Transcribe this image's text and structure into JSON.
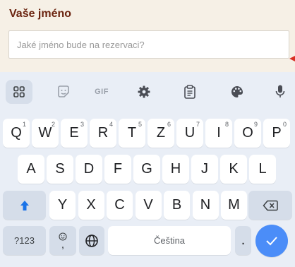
{
  "form": {
    "label": "Vaše jméno",
    "placeholder": "Jaké jméno bude na rezervaci?",
    "value": ""
  },
  "keyboard": {
    "toolbar": {
      "gif_label": "GIF",
      "icons": [
        "apps-grid-icon",
        "sticker-icon",
        "gif-icon",
        "settings-gear-icon",
        "clipboard-icon",
        "palette-icon",
        "microphone-icon"
      ]
    },
    "row1": [
      {
        "label": "Q",
        "hint": "1"
      },
      {
        "label": "W",
        "hint": "2"
      },
      {
        "label": "E",
        "hint": "3"
      },
      {
        "label": "R",
        "hint": "4"
      },
      {
        "label": "T",
        "hint": "5"
      },
      {
        "label": "Z",
        "hint": "6"
      },
      {
        "label": "U",
        "hint": "7"
      },
      {
        "label": "I",
        "hint": "8"
      },
      {
        "label": "O",
        "hint": "9"
      },
      {
        "label": "P",
        "hint": "0"
      }
    ],
    "row2": [
      "A",
      "S",
      "D",
      "F",
      "G",
      "H",
      "J",
      "K",
      "L"
    ],
    "row3": [
      "Y",
      "X",
      "C",
      "V",
      "B",
      "N",
      "M"
    ],
    "symbols_label": "?123",
    "comma_label": ",",
    "space_label": "Čeština",
    "period_label": ".",
    "accent_color": "#4b8df8"
  }
}
